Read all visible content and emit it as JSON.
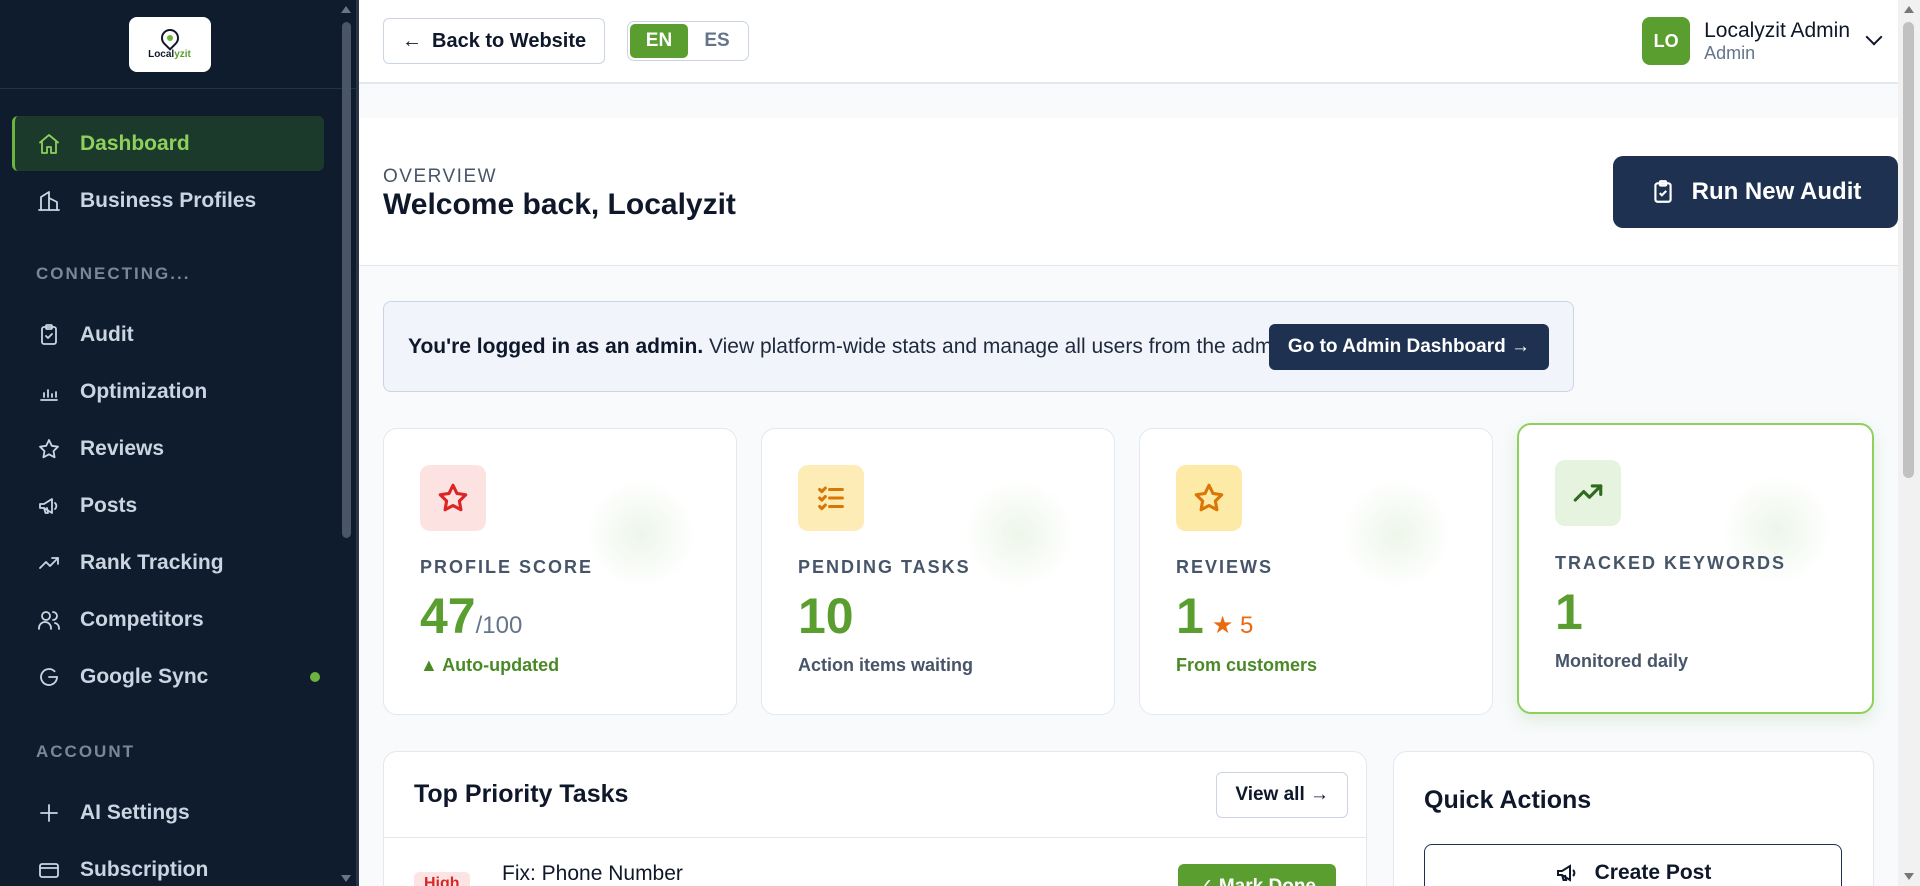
{
  "brand": {
    "logo_text_a": "Local",
    "logo_text_b": "yzit"
  },
  "sidebar": {
    "items": [
      {
        "label": "Dashboard",
        "icon": "home-icon",
        "active": true
      },
      {
        "label": "Business Profiles",
        "icon": "building-icon"
      }
    ],
    "section_connecting": "CONNECTING...",
    "connecting_items": [
      {
        "label": "Audit",
        "icon": "clipboard-icon"
      },
      {
        "label": "Optimization",
        "icon": "bar-chart-icon"
      },
      {
        "label": "Reviews",
        "icon": "star-icon"
      },
      {
        "label": "Posts",
        "icon": "megaphone-icon"
      },
      {
        "label": "Rank Tracking",
        "icon": "trending-up-icon"
      },
      {
        "label": "Competitors",
        "icon": "users-icon"
      },
      {
        "label": "Google Sync",
        "icon": "google-icon",
        "status_dot": true
      }
    ],
    "section_account": "ACCOUNT",
    "account_items": [
      {
        "label": "AI Settings",
        "icon": "plus-icon"
      },
      {
        "label": "Subscription",
        "icon": "credit-card-icon"
      }
    ]
  },
  "topbar": {
    "back_label": "Back to Website",
    "lang_en": "EN",
    "lang_es": "ES",
    "user_initials": "LO",
    "user_name": "Localyzit Admin",
    "user_role": "Admin"
  },
  "header": {
    "eyebrow": "OVERVIEW",
    "title": "Welcome back, Localyzit",
    "run_audit_label": "Run New Audit"
  },
  "alert": {
    "bold": "You're logged in as an admin.",
    "text": " View platform-wide stats and manage all users from the admin panel.",
    "button_label": "Go to Admin Dashboard →"
  },
  "stats": [
    {
      "label": "PROFILE SCORE",
      "value": "47",
      "suffix": "/100",
      "sub": "▲ Auto-updated",
      "icon": "star-outline-icon",
      "color": "#dc2626"
    },
    {
      "label": "PENDING TASKS",
      "value": "10",
      "sub": "Action items waiting",
      "icon": "checklist-icon",
      "color": "#d97706"
    },
    {
      "label": "REVIEWS",
      "value": "1",
      "rating": "★ 5",
      "sub": "From customers",
      "icon": "star-outline-icon",
      "color": "#d97706"
    },
    {
      "label": "TRACKED KEYWORDS",
      "value": "1",
      "sub": "Monitored daily",
      "icon": "trending-up-icon",
      "color": "#2f6a1f"
    }
  ],
  "tasks": {
    "title": "Top Priority Tasks",
    "view_all_label": "View all →",
    "items": [
      {
        "priority": "High",
        "name": "Fix: Phone Number",
        "action": "✓ Mark Done"
      }
    ]
  },
  "quick_actions": {
    "title": "Quick Actions",
    "create_post_label": "Create Post"
  },
  "colors": {
    "accent": "#5a9e2f",
    "navy": "#1e3150",
    "sidebar_bg": "#0f1c2e"
  }
}
